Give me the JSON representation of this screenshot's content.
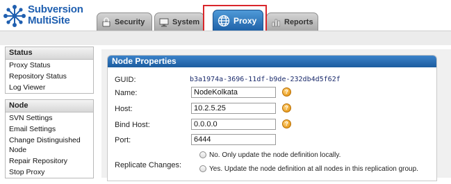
{
  "app": {
    "logo_line1": "Subversion",
    "logo_line2": "MultiSite"
  },
  "tabs": [
    {
      "label": "Security",
      "icon": "lock-icon",
      "active": false
    },
    {
      "label": "System",
      "icon": "monitor-icon",
      "active": false
    },
    {
      "label": "Proxy",
      "icon": "globe-icon",
      "active": true
    },
    {
      "label": "Reports",
      "icon": "bar-chart-icon",
      "active": false
    }
  ],
  "sidebar": {
    "sections": [
      {
        "title": "Status",
        "items": [
          "Proxy Status",
          "Repository Status",
          "Log Viewer"
        ]
      },
      {
        "title": "Node",
        "items": [
          "SVN Settings",
          "Email Settings",
          "Change Distinguished Node",
          "Repair Repository",
          "Stop Proxy"
        ]
      }
    ]
  },
  "panel": {
    "title": "Node Properties",
    "guid_label": "GUID:",
    "guid_value": "b3a1974a-3696-11df-b9de-232db4d5f62f",
    "name_label": "Name:",
    "name_value": "NodeKolkata",
    "host_label": "Host:",
    "host_value": "10.2.5.25",
    "bind_host_label": "Bind Host:",
    "bind_host_value": "0.0.0.0",
    "port_label": "Port:",
    "port_value": "6444",
    "replicate_label": "Replicate Changes:",
    "replicate_options": [
      "No. Only update the node definition locally.",
      "Yes. Update the node definition at all nodes in this replication group."
    ]
  },
  "colors": {
    "brand_blue": "#1f5fb0",
    "active_tab": "#2b74bf",
    "panel_header": "#2a6db5",
    "highlight_border": "#d9262b",
    "help_icon": "#e59a10"
  }
}
